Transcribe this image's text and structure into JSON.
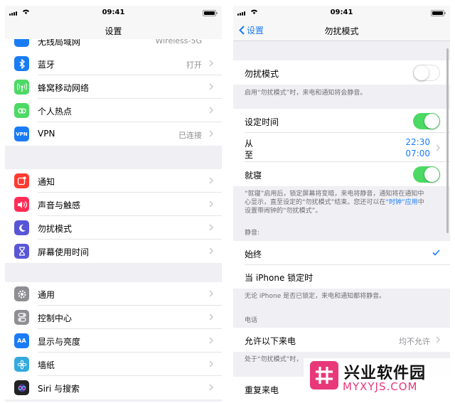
{
  "left": {
    "status": {
      "time": "09:41"
    },
    "nav": {
      "title": "设置"
    },
    "partial_row": {
      "label": "无线局域网",
      "value": "Wireless-5G"
    },
    "group1": [
      {
        "icon": "bluetooth-icon",
        "label": "蓝牙",
        "value": "打开",
        "color": "#1a7cf5"
      },
      {
        "icon": "cellular-icon",
        "label": "蜂窝移动网络",
        "value": "",
        "color": "#4cd964"
      },
      {
        "icon": "hotspot-icon",
        "label": "个人热点",
        "value": "",
        "color": "#4cd964"
      },
      {
        "icon": "vpn-icon",
        "label": "VPN",
        "value": "已连接",
        "color": "#1a7cf5",
        "badge": "VPN"
      }
    ],
    "group2": [
      {
        "icon": "notifications-icon",
        "label": "通知",
        "color": "#ff3b30"
      },
      {
        "icon": "sounds-icon",
        "label": "声音与触感",
        "color": "#ff2d55"
      },
      {
        "icon": "moon-icon",
        "label": "勿扰模式",
        "color": "#5856d6"
      },
      {
        "icon": "hourglass-icon",
        "label": "屏幕使用时间",
        "color": "#5856d6"
      }
    ],
    "group3": [
      {
        "icon": "gear-icon",
        "label": "通用",
        "color": "#8e8e93"
      },
      {
        "icon": "control-center-icon",
        "label": "控制中心",
        "color": "#8e8e93"
      },
      {
        "icon": "display-icon",
        "label": "显示与亮度",
        "color": "#1a7cf5",
        "badge": "AA"
      },
      {
        "icon": "wallpaper-icon",
        "label": "墙纸",
        "color": "#34aadc"
      },
      {
        "icon": "siri-icon",
        "label": "Siri 与搜索",
        "color": "#222222"
      }
    ]
  },
  "right": {
    "status": {
      "time": "09:41"
    },
    "nav": {
      "back_label": "设置",
      "title": "勿扰模式"
    },
    "dnd": {
      "label": "勿扰模式",
      "enabled": false,
      "note": "启用“勿扰模式”时，来电和通知将会静音。"
    },
    "scheduled": {
      "label": "设定时间",
      "enabled": true
    },
    "from_label": "从",
    "to_label": "至",
    "from_time": "22:30",
    "to_time": "07:00",
    "bedtime": {
      "label": "就寝",
      "enabled": true
    },
    "bedtime_note_1": "“就寝”启用后，锁定屏幕将变暗，来电将静音，通知将在通知中",
    "bedtime_note_2": "心显示，直至设定的“勿扰模式”结束。您还可以在",
    "bedtime_note_link": "“时钟”应用",
    "bedtime_note_3": "中",
    "bedtime_note_4": "设置带闹钟的“勿扰模式”。",
    "silence_header": "静音:",
    "always_label": "始终",
    "locked_label": "当 iPhone 锁定时",
    "locked_note": "无论 iPhone 是否已锁定，来电和通知都将静音。",
    "phone_header": "电话",
    "allow_calls_label": "允许以下来电",
    "allow_calls_value": "均不允许",
    "allow_calls_note": "处于“勿扰模式”时，",
    "repeated_label": "重复来电"
  },
  "watermark": {
    "title": "兴业软件园",
    "url": "MYXYJS.COM"
  }
}
